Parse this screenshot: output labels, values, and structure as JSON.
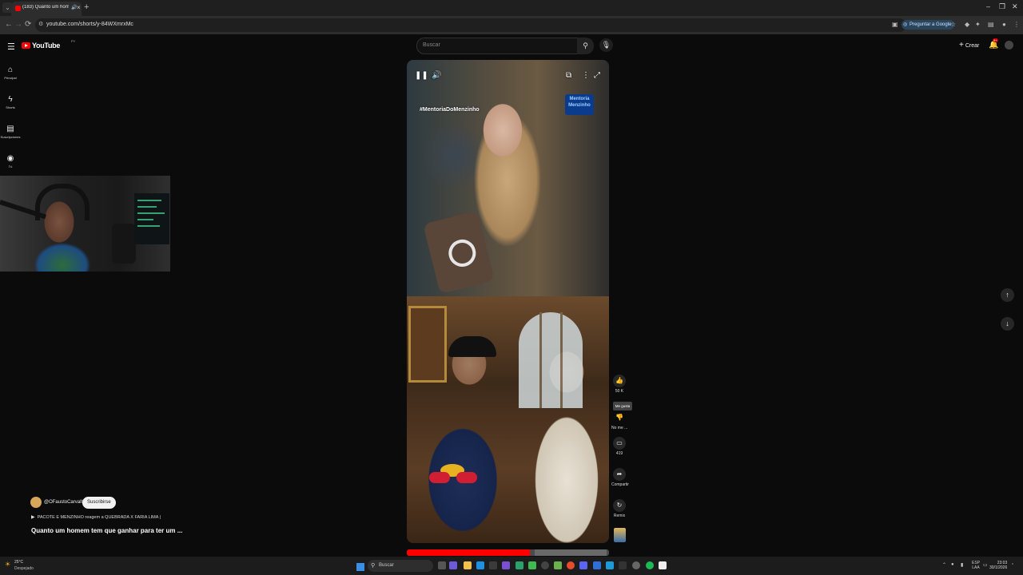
{
  "browser": {
    "tab_title": "(183) Quanto um homem t",
    "url": "youtube.com/shorts/y-84WXmrxMc",
    "ask_google": "Preguntar a Google",
    "window_controls": [
      "–",
      "❐",
      "✕"
    ]
  },
  "youtube": {
    "logo": "YouTube",
    "country_code": "PY",
    "search_placeholder": "Buscar",
    "create_label": "Crear",
    "notification_count": "9+",
    "guide": [
      {
        "icon": "home-icon",
        "label": "Principal"
      },
      {
        "icon": "shorts-icon",
        "label": "Shorts"
      },
      {
        "icon": "subscriptions-icon",
        "label": "Suscripciones"
      },
      {
        "icon": "you-icon",
        "label": "Tú"
      }
    ]
  },
  "short": {
    "overlay_hashtag": "#MentoriaDoMenzinho",
    "overlay_brand": "Mentoria Menzinho",
    "progress": 0.61,
    "actions": {
      "likes": "50 K",
      "like_tooltip": "Me gusta",
      "dislike_label": "No me ...",
      "comments": "419",
      "share_label": "Compartir",
      "remix_label": "Remix"
    },
    "channel": "@OFaustoCarvalho",
    "subscribe_label": "Suscribirse",
    "playlist": "PACOTE E MENZINHO reagem a QUEBRADA X FARIA LIMA |",
    "title": "Quanto um homem tem que ganhar para ter um ..."
  },
  "taskbar": {
    "temperature": "25°C",
    "weather": "Despejado",
    "search_label": "Buscar",
    "lang_line1": "ESP",
    "lang_line2": "LAA",
    "time": "23:03",
    "date": "30/1/2026",
    "accent": "#ff0000"
  }
}
